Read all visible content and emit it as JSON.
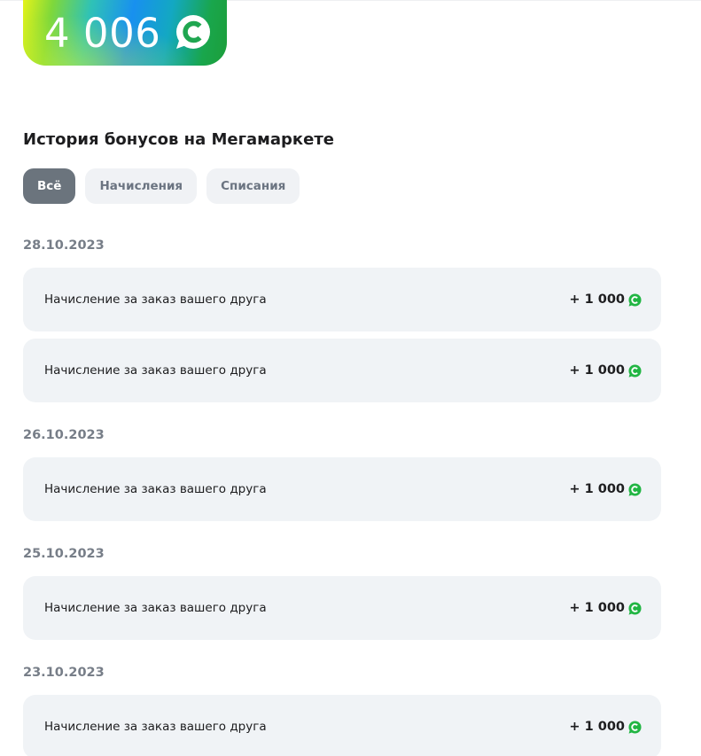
{
  "balance": {
    "amount": "4 006",
    "icon": "bonus-coin-icon"
  },
  "history": {
    "title": "История бонусов на Мегамаркете",
    "filters": [
      {
        "label": "Всё",
        "active": true
      },
      {
        "label": "Начисления",
        "active": false
      },
      {
        "label": "Списания",
        "active": false
      }
    ],
    "groups": [
      {
        "date": "28.10.2023",
        "items": [
          {
            "description": "Начисление за заказ вашего друга",
            "amount": "+ 1 000"
          },
          {
            "description": "Начисление за заказ вашего друга",
            "amount": "+ 1 000"
          }
        ]
      },
      {
        "date": "26.10.2023",
        "items": [
          {
            "description": "Начисление за заказ вашего друга",
            "amount": "+ 1 000"
          }
        ]
      },
      {
        "date": "25.10.2023",
        "items": [
          {
            "description": "Начисление за заказ вашего друга",
            "amount": "+ 1 000"
          }
        ]
      },
      {
        "date": "23.10.2023",
        "items": [
          {
            "description": "Начисление за заказ вашего друга",
            "amount": "+ 1 000"
          }
        ]
      }
    ]
  },
  "colors": {
    "coin": "#21b543",
    "chip_active": "#6b747d",
    "row_bg": "#f0f3f6"
  }
}
